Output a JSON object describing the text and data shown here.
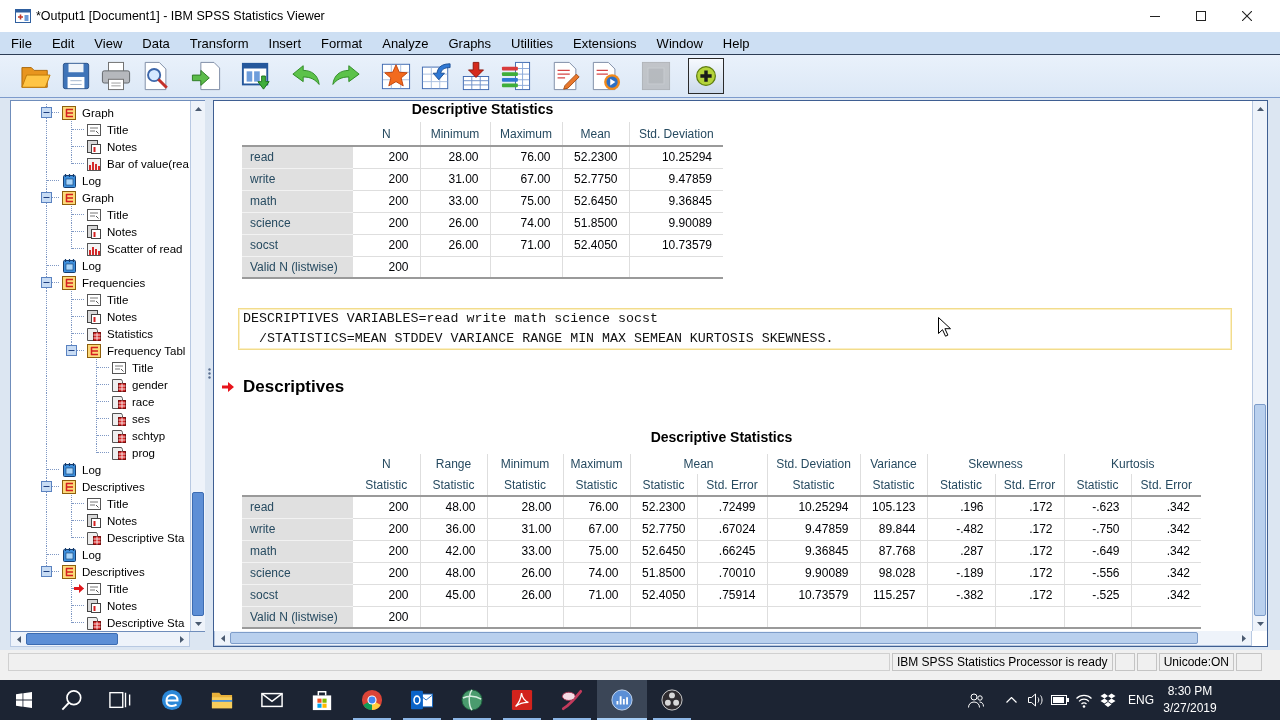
{
  "window": {
    "title": "*Output1 [Document1] - IBM SPSS Statistics Viewer"
  },
  "menu": [
    "File",
    "Edit",
    "View",
    "Data",
    "Transform",
    "Insert",
    "Format",
    "Analyze",
    "Graphs",
    "Utilities",
    "Extensions",
    "Window",
    "Help"
  ],
  "toolbar": [
    [
      {
        "kind": "open",
        "disabled": false,
        "pressed": false
      },
      {
        "kind": "save",
        "disabled": false,
        "pressed": false
      },
      {
        "kind": "print",
        "disabled": false,
        "pressed": false
      },
      {
        "kind": "preview",
        "disabled": false,
        "pressed": false
      }
    ],
    [
      {
        "kind": "export",
        "disabled": false,
        "pressed": false
      }
    ],
    [
      {
        "kind": "recall",
        "disabled": false,
        "pressed": false
      }
    ],
    [
      {
        "kind": "undo",
        "disabled": false,
        "pressed": false
      },
      {
        "kind": "redo",
        "disabled": false,
        "pressed": false
      }
    ],
    [
      {
        "kind": "star",
        "disabled": false,
        "pressed": false
      },
      {
        "kind": "goto",
        "disabled": false,
        "pressed": false
      },
      {
        "kind": "insert",
        "disabled": false,
        "pressed": false
      },
      {
        "kind": "variables",
        "disabled": false,
        "pressed": false
      }
    ],
    [
      {
        "kind": "edit",
        "disabled": false,
        "pressed": false
      },
      {
        "kind": "script",
        "disabled": false,
        "pressed": false
      }
    ],
    [
      {
        "kind": "designate",
        "disabled": true,
        "pressed": false
      }
    ],
    [
      {
        "kind": "create",
        "disabled": false,
        "pressed": true
      }
    ]
  ],
  "outline": [
    {
      "label": "Graph",
      "kind": "heading",
      "expanded": true,
      "current": false,
      "children": [
        {
          "label": "Title",
          "kind": "title",
          "current": false
        },
        {
          "label": "Notes",
          "kind": "notes",
          "current": false
        },
        {
          "label": "Bar of value(rea",
          "kind": "chart",
          "current": false
        }
      ]
    },
    {
      "label": "Log",
      "kind": "log",
      "current": false
    },
    {
      "label": "Graph",
      "kind": "heading",
      "expanded": true,
      "current": false,
      "children": [
        {
          "label": "Title",
          "kind": "title",
          "current": false
        },
        {
          "label": "Notes",
          "kind": "notes",
          "current": false
        },
        {
          "label": "Scatter of read",
          "kind": "chart",
          "current": false
        }
      ]
    },
    {
      "label": "Log",
      "kind": "log",
      "current": false
    },
    {
      "label": "Frequencies",
      "kind": "heading",
      "expanded": true,
      "current": false,
      "children": [
        {
          "label": "Title",
          "kind": "title",
          "current": false
        },
        {
          "label": "Notes",
          "kind": "notes",
          "current": false
        },
        {
          "label": "Statistics",
          "kind": "table",
          "current": false
        },
        {
          "label": "Frequency Tabl",
          "kind": "heading",
          "expanded": true,
          "current": false,
          "children": [
            {
              "label": "Title",
              "kind": "title",
              "current": false
            },
            {
              "label": "gender",
              "kind": "table",
              "current": false
            },
            {
              "label": "race",
              "kind": "table",
              "current": false
            },
            {
              "label": "ses",
              "kind": "table",
              "current": false
            },
            {
              "label": "schtyp",
              "kind": "table",
              "current": false
            },
            {
              "label": "prog",
              "kind": "table",
              "current": false
            }
          ]
        }
      ]
    },
    {
      "label": "Log",
      "kind": "log",
      "current": false
    },
    {
      "label": "Descriptives",
      "kind": "heading",
      "expanded": true,
      "current": false,
      "children": [
        {
          "label": "Title",
          "kind": "title",
          "current": false
        },
        {
          "label": "Notes",
          "kind": "notes",
          "current": false
        },
        {
          "label": "Descriptive Sta",
          "kind": "table",
          "current": false
        }
      ]
    },
    {
      "label": "Log",
      "kind": "log",
      "current": false
    },
    {
      "label": "Descriptives",
      "kind": "heading",
      "expanded": true,
      "current": false,
      "children": [
        {
          "label": "Title",
          "kind": "title",
          "current": true
        },
        {
          "label": "Notes",
          "kind": "notes",
          "current": false
        },
        {
          "label": "Descriptive Sta",
          "kind": "table",
          "current": false
        }
      ]
    }
  ],
  "output": [
    {
      "kind": "table",
      "title": "Descriptive Statistics",
      "columns": [
        "N",
        "Minimum",
        "Maximum",
        "Mean",
        "Std. Deviation"
      ],
      "rows": [
        {
          "label": "read",
          "cells": [
            "200",
            "28.00",
            "76.00",
            "52.2300",
            "10.25294"
          ]
        },
        {
          "label": "write",
          "cells": [
            "200",
            "31.00",
            "67.00",
            "52.7750",
            "9.47859"
          ]
        },
        {
          "label": "math",
          "cells": [
            "200",
            "33.00",
            "75.00",
            "52.6450",
            "9.36845"
          ]
        },
        {
          "label": "science",
          "cells": [
            "200",
            "26.00",
            "74.00",
            "51.8500",
            "9.90089"
          ]
        },
        {
          "label": "socst",
          "cells": [
            "200",
            "26.00",
            "71.00",
            "52.4050",
            "10.73579"
          ]
        },
        {
          "label": "Valid N (listwise)",
          "cells": [
            "200"
          ]
        }
      ]
    },
    {
      "kind": "syntax",
      "lines": [
        "DESCRIPTIVES VARIABLES=read write math science socst",
        "  /STATISTICS=MEAN STDDEV VARIANCE RANGE MIN MAX SEMEAN KURTOSIS SKEWNESS."
      ]
    },
    {
      "kind": "heading",
      "text": "Descriptives",
      "current": true
    },
    {
      "kind": "table",
      "title": "Descriptive Statistics",
      "column_groups": [
        {
          "label": "N"
        },
        {
          "label": "Range"
        },
        {
          "label": "Minimum"
        },
        {
          "label": "Maximum"
        },
        {
          "label": "Mean",
          "colspan": 2
        },
        {
          "label": "Std. Deviation"
        },
        {
          "label": "Variance"
        },
        {
          "label": "Skewness",
          "colspan": 2
        },
        {
          "label": "Kurtosis",
          "colspan": 2
        }
      ],
      "columns": [
        "Statistic",
        "Statistic",
        "Statistic",
        "Statistic",
        "Statistic",
        "Std. Error",
        "Statistic",
        "Statistic",
        "Statistic",
        "Std. Error",
        "Statistic",
        "Std. Error"
      ],
      "rows": [
        {
          "label": "read",
          "cells": [
            "200",
            "48.00",
            "28.00",
            "76.00",
            "52.2300",
            ".72499",
            "10.25294",
            "105.123",
            ".196",
            ".172",
            "-.623",
            ".342"
          ]
        },
        {
          "label": "write",
          "cells": [
            "200",
            "36.00",
            "31.00",
            "67.00",
            "52.7750",
            ".67024",
            "9.47859",
            "89.844",
            "-.482",
            ".172",
            "-.750",
            ".342"
          ]
        },
        {
          "label": "math",
          "cells": [
            "200",
            "42.00",
            "33.00",
            "75.00",
            "52.6450",
            ".66245",
            "9.36845",
            "87.768",
            ".287",
            ".172",
            "-.649",
            ".342"
          ]
        },
        {
          "label": "science",
          "cells": [
            "200",
            "48.00",
            "26.00",
            "74.00",
            "51.8500",
            ".70010",
            "9.90089",
            "98.028",
            "-.189",
            ".172",
            "-.556",
            ".342"
          ]
        },
        {
          "label": "socst",
          "cells": [
            "200",
            "45.00",
            "26.00",
            "71.00",
            "52.4050",
            ".75914",
            "10.73579",
            "115.257",
            "-.382",
            ".172",
            "-.525",
            ".342"
          ]
        },
        {
          "label": "Valid N (listwise)",
          "cells": [
            "200"
          ]
        }
      ]
    }
  ],
  "status_bar": {
    "message": "IBM SPSS Statistics Processor is ready",
    "encoding": "Unicode:ON"
  },
  "taskbar": {
    "buttons": [
      {
        "kind": "start",
        "running": false,
        "active": false
      },
      {
        "kind": "search",
        "running": false,
        "active": false
      },
      {
        "kind": "taskview",
        "running": false,
        "active": false
      },
      {
        "kind": "browser",
        "running": false,
        "active": false
      },
      {
        "kind": "folder",
        "running": false,
        "active": false
      },
      {
        "kind": "mail",
        "running": false,
        "active": false
      },
      {
        "kind": "store",
        "running": false,
        "active": false
      },
      {
        "kind": "web",
        "running": true,
        "active": false
      },
      {
        "kind": "email",
        "running": true,
        "active": false
      },
      {
        "kind": "globe",
        "running": true,
        "active": false
      },
      {
        "kind": "pdf",
        "running": true,
        "active": false
      },
      {
        "kind": "paint",
        "running": true,
        "active": false
      },
      {
        "kind": "stats",
        "running": true,
        "active": true
      },
      {
        "kind": "recorder",
        "running": true,
        "active": false
      }
    ],
    "tray": {
      "language": "ENG",
      "time": "8:30 PM",
      "date": "3/27/2019"
    }
  }
}
